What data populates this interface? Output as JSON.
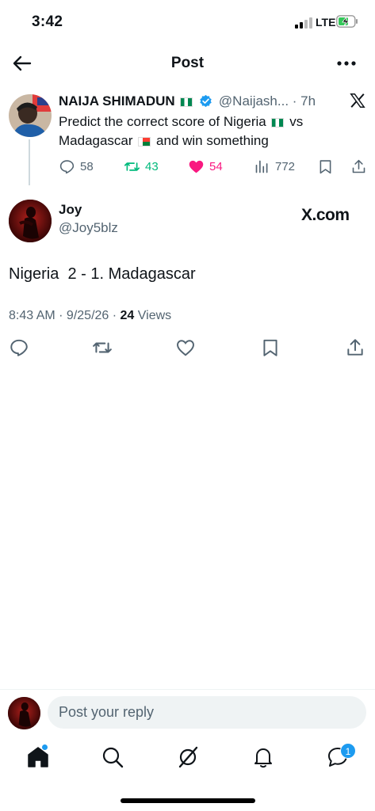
{
  "status_bar": {
    "time": "3:42",
    "network": "LTE"
  },
  "header": {
    "title": "Post"
  },
  "parent_tweet": {
    "author_name": "NAIJA SHIMADUN",
    "handle": "@Naijash...",
    "time": "· 7h",
    "text_part1": "Predict the correct score of Nigeria",
    "text_part2": "vs",
    "text_part3": "Madagascar",
    "text_part4": "and win something",
    "replies": "58",
    "reposts": "43",
    "likes": "54",
    "views": "772"
  },
  "reply_tweet": {
    "author_name": "Joy",
    "handle": "@Joy5blz",
    "source_label": "X.com",
    "text": "Nigeria  2 - 1. Madagascar",
    "timestamp": "8:43 AM · 9/25/26 · ",
    "views_count": "24",
    "views_label": " Views"
  },
  "reply_bar": {
    "placeholder": "Post your reply"
  },
  "nav": {
    "messages_badge": "1"
  },
  "colors": {
    "accent": "#1d9bf0",
    "repost": "#00ba7c",
    "like": "#f91880",
    "muted": "#536471"
  }
}
